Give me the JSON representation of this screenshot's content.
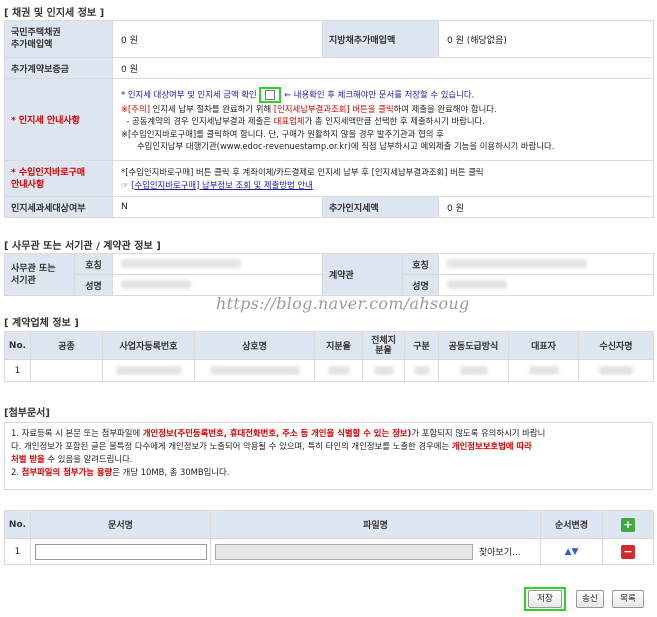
{
  "bond_section": {
    "title": "[ 채권 및 인지세 정보 ]",
    "national_bond_label": "국민주택채권\n추가매입액",
    "national_bond_value": "0 원",
    "local_bond_label": "지방채추가매입액",
    "local_bond_value": "0 원 (해당없음)",
    "contract_deposit_label": "추가계약보증금",
    "contract_deposit_value": "0 원",
    "stamp_guide_label": "인지세 안내사항",
    "stamp_line1_a": "* 인지세 대상여부 및 인지세 금액 확인",
    "stamp_line1_b": "← 내용확인 후 체크해야만 문서를 저장할 수 있습니다.",
    "stamp_line2_a": "※[주의]",
    "stamp_line2_b": " 인지세 납부 절차를 완료하기 위해 ",
    "stamp_line2_c": "[인지세납부결과조회] 버튼을 클릭",
    "stamp_line2_d": "하여 제출을 완료해야 합니다.",
    "stamp_line3_a": "  - 공동계약의 경우 인지세납부결과 제출은 ",
    "stamp_line3_b": "대표업체",
    "stamp_line3_c": "가 총 인지세액만큼 선택한 후 제출하시기 바랍니다.",
    "stamp_line4": "※[수입인지바로구매]를 클릭하여 합니다. 단, 구매가 원활하지 않을 경우 발주기관과 협의 후",
    "stamp_line5": "      수입인지납부 대행기관(www.edoc-revenuestamp.or.kr)에 직접 납부하시고 예외제출 기능을 이용하시기 바랍니다.",
    "stamp_buy_label": "수입인지바로구매\n안내사항",
    "stamp_buy_line1": "*[수입인지바로구매] 버튼 클릭 후 계좌이체/카드결제로 인지세 납부 후 [인지세납부결과조회] 버튼 클릭",
    "stamp_buy_line2": "[수입인지바로구매] 납부정보 조회 및 제출방법 안내",
    "stamp_target_label": "인지세과세대상여부",
    "stamp_target_value": "N",
    "additional_stamp_label": "추가인지세액",
    "additional_stamp_value": "0 원"
  },
  "office_section": {
    "title": "[ 사무관 또는 서기관 / 계약관 정보 ]",
    "office_label": "사무관 또는\n서기관",
    "contract_officer_label": "계약관",
    "title_field": "호칭",
    "name_field": "성명"
  },
  "watermark": "https://blog.naver.com/ahsoug",
  "company_section": {
    "title": "[ 계약업체 정보 ]",
    "columns": [
      "No.",
      "공종",
      "사업자등록번호",
      "상호명",
      "지분율",
      "전체지분율",
      "구분",
      "공동도급방식",
      "대표자",
      "수신자명"
    ],
    "rows": [
      {
        "no": "1"
      }
    ]
  },
  "attachment_section": {
    "title": "[첨부문서]",
    "notice1_a": "1. 자료등록 시 본문 또는 첨부파일에 ",
    "notice1_b": "개인정보(주민등록번호, 휴대전화번호, 주소 등 개인을 식별할 수 있는 정보)",
    "notice1_c": "가 포함되지 않도록 유의하시기 바랍니",
    "notice2_a": "다. 개인정보가 포함된 글은 불특정 다수에게 개인정보가 노출되어 악용될 수 있으며, 특히 타인의 개인정보를 노출한 경우에는 ",
    "notice2_b": "개인정보보호법에 따라",
    "notice3_a": "처벌 받을",
    "notice3_b": " 수 있음을 알려드립니다.",
    "notice4_a": "2. ",
    "notice4_b": "첨부파일의 첨부가능 용량",
    "notice4_c": "은 개당 10MB, 총 30MB입니다.",
    "columns": [
      "No.",
      "문서명",
      "파일명",
      "순서변경"
    ],
    "row_no": "1",
    "browse_label": "찾아보기...",
    "order_arrows": "▲▼"
  },
  "buttons": {
    "save": "저장",
    "send": "송신",
    "list": "목록"
  },
  "colors": {
    "header_bg": "#dde5f0",
    "accent_red": "#d40000",
    "accent_blue": "#1a1aa8",
    "highlight_green": "#2bd32b",
    "add_button": "#3fa83f",
    "remove_button": "#d22b2b"
  }
}
